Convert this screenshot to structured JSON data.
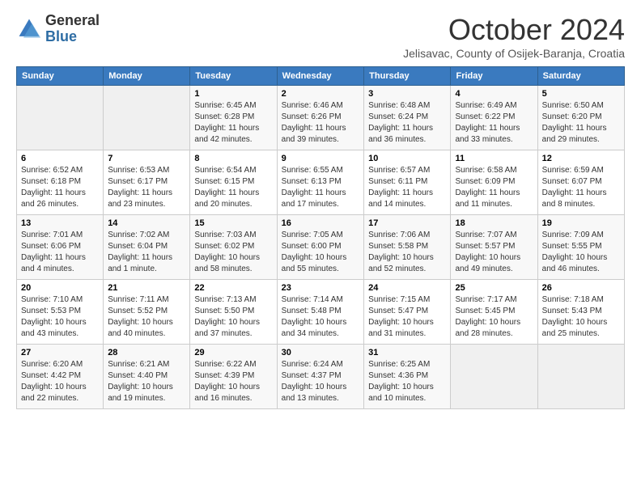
{
  "logo": {
    "general": "General",
    "blue": "Blue"
  },
  "header": {
    "month": "October 2024",
    "location": "Jelisavac, County of Osijek-Baranja, Croatia"
  },
  "days_of_week": [
    "Sunday",
    "Monday",
    "Tuesday",
    "Wednesday",
    "Thursday",
    "Friday",
    "Saturday"
  ],
  "weeks": [
    [
      {
        "day": "",
        "info": ""
      },
      {
        "day": "",
        "info": ""
      },
      {
        "day": "1",
        "info": "Sunrise: 6:45 AM\nSunset: 6:28 PM\nDaylight: 11 hours and 42 minutes."
      },
      {
        "day": "2",
        "info": "Sunrise: 6:46 AM\nSunset: 6:26 PM\nDaylight: 11 hours and 39 minutes."
      },
      {
        "day": "3",
        "info": "Sunrise: 6:48 AM\nSunset: 6:24 PM\nDaylight: 11 hours and 36 minutes."
      },
      {
        "day": "4",
        "info": "Sunrise: 6:49 AM\nSunset: 6:22 PM\nDaylight: 11 hours and 33 minutes."
      },
      {
        "day": "5",
        "info": "Sunrise: 6:50 AM\nSunset: 6:20 PM\nDaylight: 11 hours and 29 minutes."
      }
    ],
    [
      {
        "day": "6",
        "info": "Sunrise: 6:52 AM\nSunset: 6:18 PM\nDaylight: 11 hours and 26 minutes."
      },
      {
        "day": "7",
        "info": "Sunrise: 6:53 AM\nSunset: 6:17 PM\nDaylight: 11 hours and 23 minutes."
      },
      {
        "day": "8",
        "info": "Sunrise: 6:54 AM\nSunset: 6:15 PM\nDaylight: 11 hours and 20 minutes."
      },
      {
        "day": "9",
        "info": "Sunrise: 6:55 AM\nSunset: 6:13 PM\nDaylight: 11 hours and 17 minutes."
      },
      {
        "day": "10",
        "info": "Sunrise: 6:57 AM\nSunset: 6:11 PM\nDaylight: 11 hours and 14 minutes."
      },
      {
        "day": "11",
        "info": "Sunrise: 6:58 AM\nSunset: 6:09 PM\nDaylight: 11 hours and 11 minutes."
      },
      {
        "day": "12",
        "info": "Sunrise: 6:59 AM\nSunset: 6:07 PM\nDaylight: 11 hours and 8 minutes."
      }
    ],
    [
      {
        "day": "13",
        "info": "Sunrise: 7:01 AM\nSunset: 6:06 PM\nDaylight: 11 hours and 4 minutes."
      },
      {
        "day": "14",
        "info": "Sunrise: 7:02 AM\nSunset: 6:04 PM\nDaylight: 11 hours and 1 minute."
      },
      {
        "day": "15",
        "info": "Sunrise: 7:03 AM\nSunset: 6:02 PM\nDaylight: 10 hours and 58 minutes."
      },
      {
        "day": "16",
        "info": "Sunrise: 7:05 AM\nSunset: 6:00 PM\nDaylight: 10 hours and 55 minutes."
      },
      {
        "day": "17",
        "info": "Sunrise: 7:06 AM\nSunset: 5:58 PM\nDaylight: 10 hours and 52 minutes."
      },
      {
        "day": "18",
        "info": "Sunrise: 7:07 AM\nSunset: 5:57 PM\nDaylight: 10 hours and 49 minutes."
      },
      {
        "day": "19",
        "info": "Sunrise: 7:09 AM\nSunset: 5:55 PM\nDaylight: 10 hours and 46 minutes."
      }
    ],
    [
      {
        "day": "20",
        "info": "Sunrise: 7:10 AM\nSunset: 5:53 PM\nDaylight: 10 hours and 43 minutes."
      },
      {
        "day": "21",
        "info": "Sunrise: 7:11 AM\nSunset: 5:52 PM\nDaylight: 10 hours and 40 minutes."
      },
      {
        "day": "22",
        "info": "Sunrise: 7:13 AM\nSunset: 5:50 PM\nDaylight: 10 hours and 37 minutes."
      },
      {
        "day": "23",
        "info": "Sunrise: 7:14 AM\nSunset: 5:48 PM\nDaylight: 10 hours and 34 minutes."
      },
      {
        "day": "24",
        "info": "Sunrise: 7:15 AM\nSunset: 5:47 PM\nDaylight: 10 hours and 31 minutes."
      },
      {
        "day": "25",
        "info": "Sunrise: 7:17 AM\nSunset: 5:45 PM\nDaylight: 10 hours and 28 minutes."
      },
      {
        "day": "26",
        "info": "Sunrise: 7:18 AM\nSunset: 5:43 PM\nDaylight: 10 hours and 25 minutes."
      }
    ],
    [
      {
        "day": "27",
        "info": "Sunrise: 6:20 AM\nSunset: 4:42 PM\nDaylight: 10 hours and 22 minutes."
      },
      {
        "day": "28",
        "info": "Sunrise: 6:21 AM\nSunset: 4:40 PM\nDaylight: 10 hours and 19 minutes."
      },
      {
        "day": "29",
        "info": "Sunrise: 6:22 AM\nSunset: 4:39 PM\nDaylight: 10 hours and 16 minutes."
      },
      {
        "day": "30",
        "info": "Sunrise: 6:24 AM\nSunset: 4:37 PM\nDaylight: 10 hours and 13 minutes."
      },
      {
        "day": "31",
        "info": "Sunrise: 6:25 AM\nSunset: 4:36 PM\nDaylight: 10 hours and 10 minutes."
      },
      {
        "day": "",
        "info": ""
      },
      {
        "day": "",
        "info": ""
      }
    ]
  ]
}
